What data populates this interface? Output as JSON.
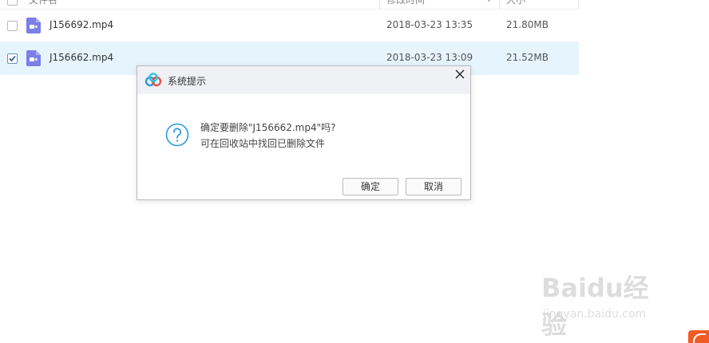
{
  "file_list": {
    "header": {
      "name": "文件名",
      "modified": "修改时间",
      "size": "大小"
    },
    "rows": [
      {
        "name": "J156692.mp4",
        "modified": "2018-03-23 13:35",
        "size": "21.80MB",
        "checked": false,
        "icon": "video-file-icon"
      },
      {
        "name": "J156662.mp4",
        "modified": "2018-03-23 13:09",
        "size": "21.52MB",
        "checked": true,
        "icon": "video-file-icon"
      }
    ]
  },
  "dialog": {
    "title": "系统提示",
    "message_line1": "确定要删除\"J156662.mp4\"吗?",
    "message_line2": "可在回收站中找回已删除文件",
    "confirm_label": "确定",
    "cancel_label": "取消",
    "icons": {
      "logo": "baidu-netdisk-logo-icon",
      "close": "close-icon",
      "question": "question-mark-icon"
    }
  },
  "watermark": {
    "brand": "Baidu经验",
    "url": "jingyan.baidu.com"
  },
  "colors": {
    "selected_row": "#e6f4fd",
    "accent": "#2b9ae0",
    "file_icon": "#7b7fe6",
    "titlebar": "#f0f1f5"
  }
}
